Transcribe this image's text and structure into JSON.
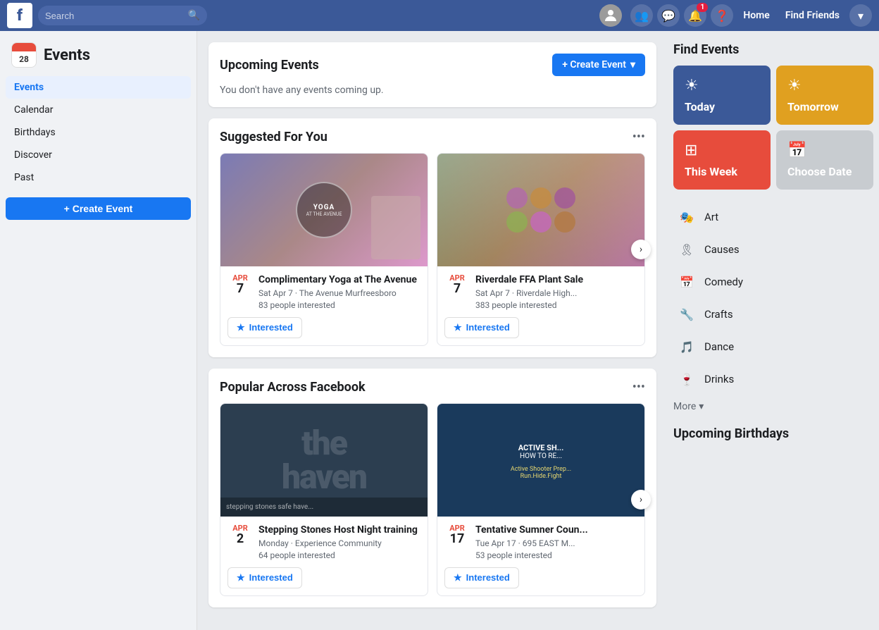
{
  "topnav": {
    "logo": "f",
    "search_placeholder": "Search",
    "username": "",
    "nav_buttons": [
      "Home",
      "Find Friends"
    ],
    "home_label": "Home",
    "find_friends_label": "Find Friends",
    "notifications_count": "1"
  },
  "sidebar": {
    "title": "Events",
    "calendar_month": "28",
    "nav_items": [
      {
        "label": "Events",
        "active": true
      },
      {
        "label": "Calendar",
        "active": false
      },
      {
        "label": "Birthdays",
        "active": false
      },
      {
        "label": "Discover",
        "active": false
      },
      {
        "label": "Past",
        "active": false
      }
    ],
    "create_event_label": "+ Create Event"
  },
  "upcoming_events": {
    "title": "Upcoming Events",
    "empty_text": "You don't have any events coming up.",
    "create_button": "+ Create Event"
  },
  "suggested": {
    "title": "Suggested For You",
    "events": [
      {
        "month": "APR",
        "day": "7",
        "name": "Complimentary Yoga at The Avenue",
        "date_detail": "Sat Apr 7 · The Avenue Murfreesboro",
        "interested_count": "83 people interested",
        "interested_label": "Interested"
      },
      {
        "month": "APR",
        "day": "7",
        "name": "Riverdale FFA Plant Sale",
        "date_detail": "Sat Apr 7 · Riverdale High...",
        "interested_count": "383 people interested",
        "interested_label": "Interested"
      }
    ]
  },
  "popular": {
    "title": "Popular Across Facebook",
    "events": [
      {
        "month": "APR",
        "day": "2",
        "name": "Stepping Stones Host Night training",
        "date_detail": "Monday · Experience Community",
        "interested_count": "64 people interested",
        "interested_label": "Interested"
      },
      {
        "month": "APR",
        "day": "17",
        "name": "Tentative Sumner Coun...",
        "date_detail": "Tue Apr 17 · 695 EAST M...",
        "interested_count": "53 people interested",
        "interested_label": "Interested"
      }
    ]
  },
  "find_events": {
    "title": "Find Events",
    "date_tiles": [
      {
        "key": "today",
        "label": "Today",
        "icon": "☀"
      },
      {
        "key": "tomorrow",
        "label": "Tomorrow",
        "icon": "☀"
      },
      {
        "key": "this_week",
        "label": "This Week",
        "icon": "⊞"
      },
      {
        "key": "choose_date",
        "label": "Choose Date",
        "icon": "📅"
      }
    ],
    "categories": [
      {
        "key": "art",
        "label": "Art",
        "icon": "🎭"
      },
      {
        "key": "causes",
        "label": "Causes",
        "icon": "🎗"
      },
      {
        "key": "comedy",
        "label": "Comedy",
        "icon": "📅"
      },
      {
        "key": "crafts",
        "label": "Crafts",
        "icon": "🔧"
      },
      {
        "key": "dance",
        "label": "Dance",
        "icon": "🎵"
      },
      {
        "key": "drinks",
        "label": "Drinks",
        "icon": "🍷"
      }
    ],
    "more_label": "More"
  },
  "upcoming_birthdays": {
    "title": "Upcoming Birthdays"
  },
  "icons": {
    "search": "🔍",
    "more_options": "•••",
    "chevron_right": "›",
    "chevron_down": "▾",
    "star": "★",
    "plus": "+"
  }
}
